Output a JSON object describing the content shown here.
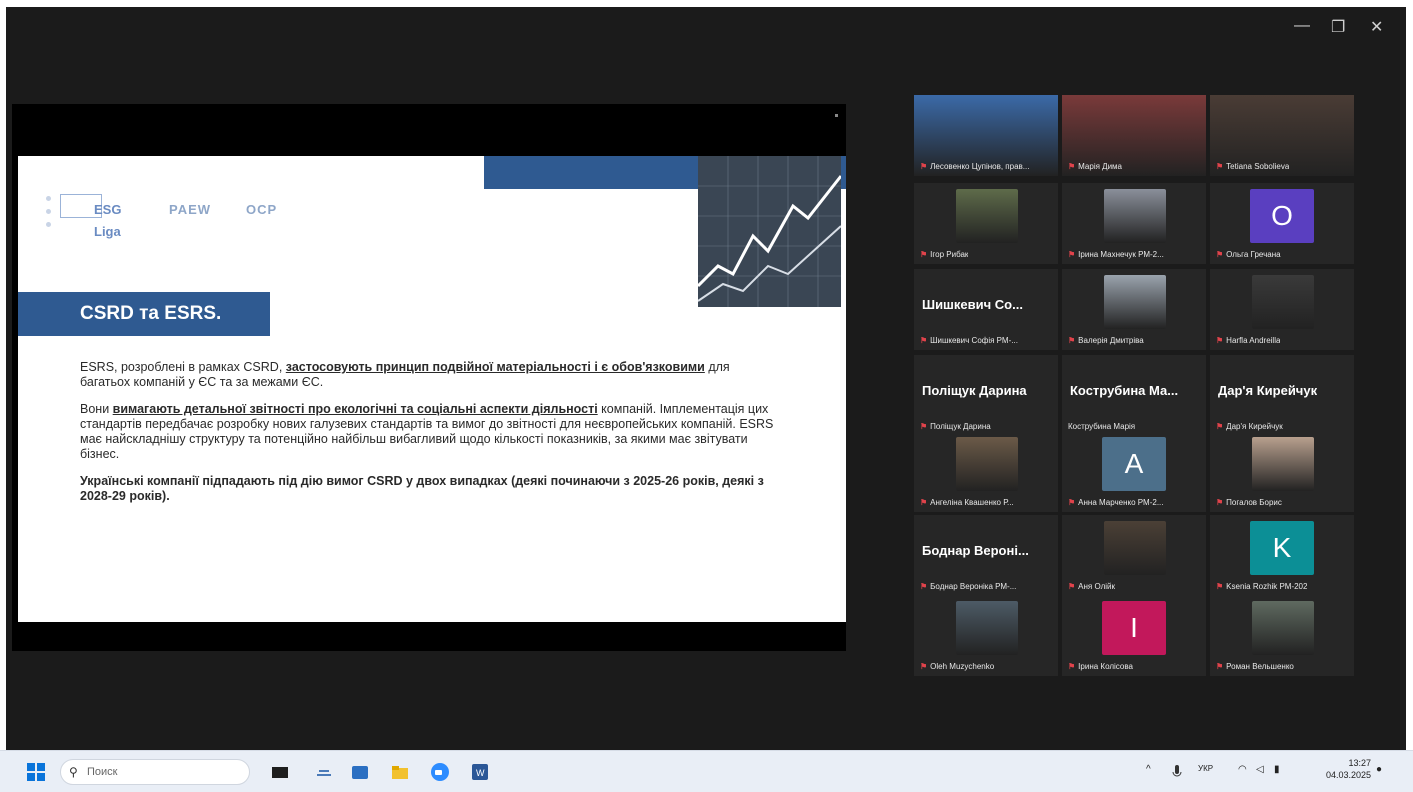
{
  "window": {
    "minimize_glyph": "—",
    "restore_glyph": "❐",
    "close_glyph": "✕"
  },
  "slide": {
    "logo": {
      "esg": "ESG",
      "liga": "Liga",
      "paew": "PAEW",
      "ocp": "OCP"
    },
    "title": "CSRD та ESRS.",
    "p1_a": "ESRS, розроблені в рамках CSRD, ",
    "p1_b": "застосовують принцип подвійної матеріальності і є обов'язковими",
    "p1_c": " для багатьох компаній у ЄС та за межами ЄС.",
    "p2_a": "Вони ",
    "p2_b": "вимагають детальної звітності про екологічні та соціальні аспекти діяльності",
    "p2_c": " компаній. Імплементація цих стандартів передбачає розробку нових галузевих стандартів та вимог до звітності для неєвропейських компаній. ESRS має найскладнішу структуру та потенційно найбільш вибагливий щодо кількості показників, за якими має звітувати бізнес.",
    "p3": "Українські компанії підпадають під дію вимог CSRD у двох випадках (деякі починаючи з 2025-26 років, деякі з 2028-29 років)."
  },
  "participants": [
    {
      "name": "Лесовенко Цупінов, прав...",
      "big": "",
      "letter": "",
      "color": "#3b6aa8"
    },
    {
      "name": "Марія Дима",
      "big": "",
      "letter": "",
      "color": "#7a3a3a"
    },
    {
      "name": "Tetiana Sobolieva",
      "big": "",
      "letter": "",
      "color": "#4a3c35"
    },
    {
      "name": "Ігор Рибак",
      "big": "",
      "letter": "",
      "color": "#5e6b4a"
    },
    {
      "name": "Ірина Махнечук РМ-2...",
      "big": "",
      "letter": "",
      "color": "#8a8f9a"
    },
    {
      "name": "Ольга Гречана",
      "big": "",
      "letter": "O",
      "color": "#5a3fc0"
    },
    {
      "name": "Шишкевич Софія РМ-...",
      "big": "Шишкевич Со...",
      "letter": "",
      "color": ""
    },
    {
      "name": "Валерія Дмитріва",
      "big": "",
      "letter": "",
      "color": "#9aa3ad"
    },
    {
      "name": "Harfla Andreilla",
      "big": "",
      "letter": "",
      "color": "#3a3a3a"
    },
    {
      "name": "Поліщук Дарина",
      "big": "Поліщук Дарина",
      "letter": "",
      "color": ""
    },
    {
      "name": "Кострубина Марія",
      "big": "Кострубина Ма...",
      "letter": "",
      "color": ""
    },
    {
      "name": "Дар'я Кирейчук",
      "big": "Дар'я Кирейчук",
      "letter": "",
      "color": ""
    },
    {
      "name": "Ангеліна Квашенко Р...",
      "big": "",
      "letter": "",
      "color": "#6b5a48"
    },
    {
      "name": "Анна Марченко РМ-2...",
      "big": "",
      "letter": "A",
      "color": "#4c6f8a"
    },
    {
      "name": "Погалов Борис",
      "big": "",
      "letter": "",
      "color": "#b8a08e"
    },
    {
      "name": "Боднар Вероніка РМ-...",
      "big": "Боднар Вероні...",
      "letter": "",
      "color": ""
    },
    {
      "name": "Аня Олійк",
      "big": "",
      "letter": "",
      "color": "#4b4036"
    },
    {
      "name": "Ksenia Rozhik РМ-202",
      "big": "",
      "letter": "K",
      "color": "#0c8f96"
    },
    {
      "name": "Oleh Muzychenko",
      "big": "",
      "letter": "",
      "color": "#4d5b66"
    },
    {
      "name": "Ірина Колісова",
      "big": "",
      "letter": "I",
      "color": "#c2185b"
    },
    {
      "name": "Роман Вельшенко",
      "big": "",
      "letter": "",
      "color": "#5f6a60"
    }
  ],
  "taskbar": {
    "search_placeholder": "Поиск",
    "lang": "УКР",
    "time": "13:27",
    "date": "04.03.2025"
  }
}
